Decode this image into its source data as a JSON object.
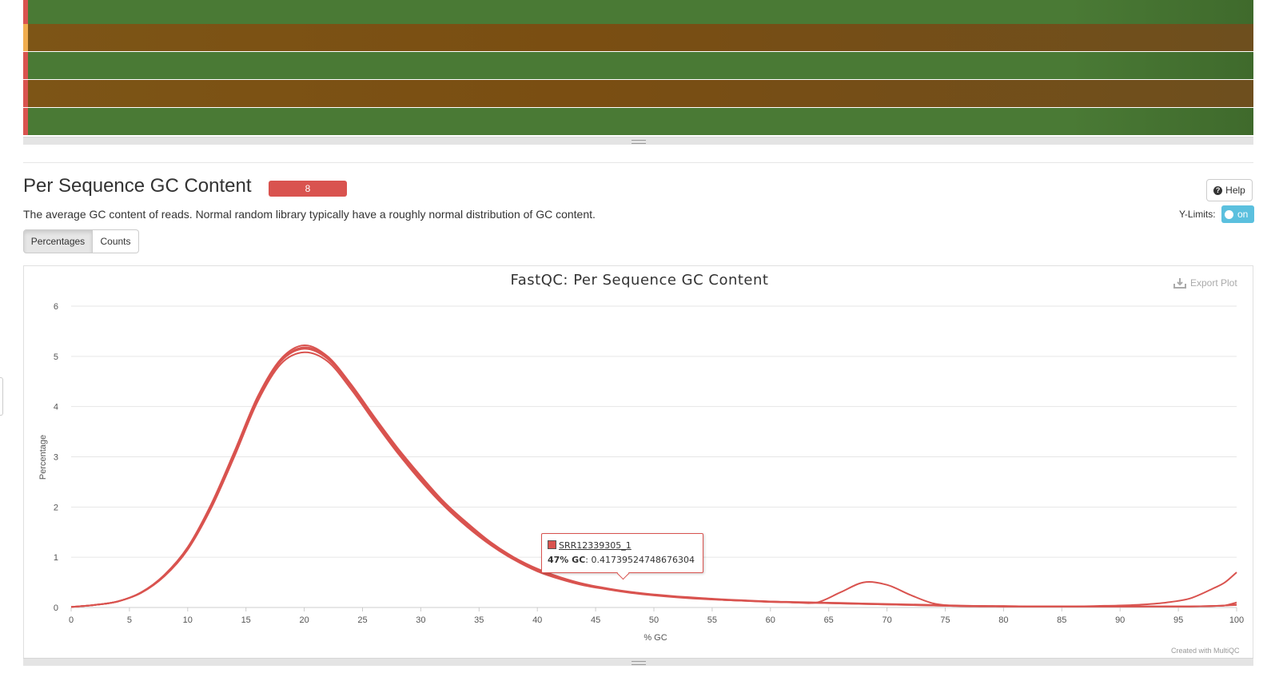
{
  "section": {
    "title": "Per Sequence GC Content",
    "badge_count": "8",
    "badge_color": "#d9534f",
    "description": "The average GC content of reads. Normal random library typically have a roughly normal distribution of GC content."
  },
  "controls": {
    "help_label": "Help",
    "help_icon": "question-circle-icon",
    "ylimits_label": "Y-Limits:",
    "ylimits_toggle": "on",
    "tabs": [
      {
        "label": "Percentages",
        "active": true
      },
      {
        "label": "Counts",
        "active": false
      }
    ]
  },
  "plot": {
    "export_label": "Export Plot",
    "export_icon": "download-icon",
    "credit": "Created with MultiQC"
  },
  "heatmap": {
    "rows": [
      {
        "status": "fail",
        "color": "#4a7a35"
      },
      {
        "status": "warn",
        "color": "#7a4e12"
      },
      {
        "status": "fail",
        "color": "#4a7a35"
      },
      {
        "status": "fail",
        "color": "#7a4e12"
      },
      {
        "status": "fail",
        "color": "#4a7a35"
      }
    ],
    "status_colors": {
      "fail": "#d9534f",
      "warn": "#f0ad4e"
    }
  },
  "tooltip": {
    "sample": "SRR12339305_1",
    "x_label": "47% GC",
    "value": "0.41739524748676304"
  },
  "chart_data": {
    "type": "line",
    "title": "FastQC: Per Sequence GC Content",
    "xlabel": "% GC",
    "ylabel": "Percentage",
    "xlim": [
      0,
      100
    ],
    "ylim": [
      0,
      6
    ],
    "x_ticks": [
      0,
      5,
      10,
      15,
      20,
      25,
      30,
      35,
      40,
      45,
      50,
      55,
      60,
      65,
      70,
      75,
      80,
      85,
      90,
      95,
      100
    ],
    "y_ticks": [
      0,
      1,
      2,
      3,
      4,
      5,
      6
    ],
    "grid": true,
    "legend": "none",
    "x": [
      0,
      2,
      4,
      6,
      8,
      10,
      12,
      14,
      16,
      18,
      20,
      22,
      24,
      26,
      28,
      30,
      32,
      34,
      36,
      38,
      40,
      42,
      44,
      46,
      48,
      50,
      52,
      54,
      56,
      58,
      60,
      62,
      64,
      66,
      68,
      70,
      72,
      74,
      76,
      78,
      80,
      82,
      84,
      86,
      88,
      90,
      92,
      94,
      96,
      98,
      99,
      100
    ],
    "series": [
      {
        "color": "#d9534f",
        "values": [
          0.01,
          0.05,
          0.12,
          0.3,
          0.65,
          1.2,
          2.05,
          3.1,
          4.2,
          4.95,
          5.22,
          5.0,
          4.45,
          3.8,
          3.18,
          2.62,
          2.1,
          1.68,
          1.3,
          1.0,
          0.77,
          0.6,
          0.47,
          0.38,
          0.31,
          0.26,
          0.22,
          0.19,
          0.16,
          0.14,
          0.12,
          0.11,
          0.1,
          0.09,
          0.08,
          0.07,
          0.06,
          0.05,
          0.04,
          0.03,
          0.03,
          0.02,
          0.02,
          0.02,
          0.02,
          0.02,
          0.02,
          0.02,
          0.02,
          0.03,
          0.04,
          0.1
        ]
      },
      {
        "color": "#d9534f",
        "values": [
          0.01,
          0.05,
          0.12,
          0.29,
          0.63,
          1.17,
          2.0,
          3.05,
          4.15,
          4.9,
          5.15,
          4.95,
          4.4,
          3.75,
          3.12,
          2.56,
          2.05,
          1.63,
          1.26,
          0.97,
          0.74,
          0.58,
          0.46,
          0.37,
          0.3,
          0.25,
          0.21,
          0.18,
          0.15,
          0.13,
          0.12,
          0.1,
          0.09,
          0.08,
          0.07,
          0.06,
          0.05,
          0.04,
          0.03,
          0.03,
          0.02,
          0.02,
          0.02,
          0.02,
          0.02,
          0.02,
          0.02,
          0.02,
          0.02,
          0.03,
          0.04,
          0.06
        ]
      },
      {
        "color": "#d9534f",
        "values": [
          0.01,
          0.05,
          0.12,
          0.29,
          0.62,
          1.15,
          1.97,
          3.0,
          4.1,
          4.85,
          5.08,
          4.9,
          4.35,
          3.7,
          3.08,
          2.52,
          2.02,
          1.6,
          1.24,
          0.95,
          0.72,
          0.56,
          0.44,
          0.36,
          0.29,
          0.24,
          0.2,
          0.17,
          0.15,
          0.13,
          0.11,
          0.1,
          0.09,
          0.08,
          0.07,
          0.06,
          0.05,
          0.04,
          0.03,
          0.03,
          0.02,
          0.02,
          0.02,
          0.02,
          0.02,
          0.02,
          0.02,
          0.02,
          0.02,
          0.03,
          0.04,
          0.05
        ]
      },
      {
        "color": "#d9534f",
        "values": [
          0.01,
          0.05,
          0.12,
          0.3,
          0.64,
          1.19,
          2.02,
          3.08,
          4.18,
          4.92,
          5.18,
          4.98,
          4.42,
          3.77,
          3.15,
          2.59,
          2.07,
          1.65,
          1.28,
          0.98,
          0.75,
          0.59,
          0.46,
          0.37,
          0.3,
          0.25,
          0.21,
          0.18,
          0.15,
          0.13,
          0.12,
          0.1,
          0.1,
          0.3,
          0.5,
          0.45,
          0.25,
          0.08,
          0.03,
          0.02,
          0.02,
          0.02,
          0.02,
          0.02,
          0.03,
          0.04,
          0.06,
          0.1,
          0.18,
          0.38,
          0.5,
          0.7
        ]
      }
    ]
  }
}
